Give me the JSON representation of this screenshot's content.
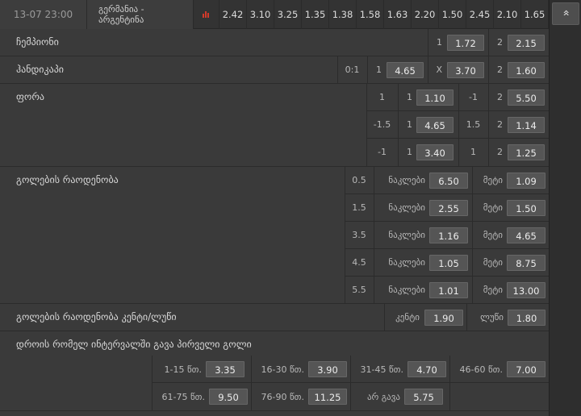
{
  "header": {
    "time": "13-07 23:00",
    "team1": "გერმანია -",
    "team2": "არგენტინა",
    "odds": [
      "2.42",
      "3.10",
      "3.25",
      "1.35",
      "1.38",
      "1.58",
      "1.63",
      "2.20",
      "1.50",
      "2.45",
      "2.10",
      "1.65"
    ]
  },
  "markets": {
    "champion": {
      "title": "ჩემპიონი",
      "l1": "1",
      "v1": "1.72",
      "l2": "2",
      "v2": "2.15"
    },
    "handicap": {
      "title": "ჰანდიკაპი",
      "hc": "0:1",
      "l1": "1",
      "v1": "4.65",
      "lx": "X",
      "vx": "3.70",
      "l2": "2",
      "v2": "1.60"
    },
    "fora": {
      "title": "ფორა",
      "rows": [
        {
          "h1": "1",
          "l1": "1",
          "v1": "1.10",
          "h2": "-1",
          "l2": "2",
          "v2": "5.50"
        },
        {
          "h1": "-1.5",
          "l1": "1",
          "v1": "4.65",
          "h2": "1.5",
          "l2": "2",
          "v2": "1.14"
        },
        {
          "h1": "-1",
          "l1": "1",
          "v1": "3.40",
          "h2": "1",
          "l2": "2",
          "v2": "1.25"
        }
      ]
    },
    "goals": {
      "title": "გოლების რაოდენობა",
      "under_label": "ნაკლები",
      "over_label": "მეტი",
      "rows": [
        {
          "total": "0.5",
          "under": "6.50",
          "over": "1.09"
        },
        {
          "total": "1.5",
          "under": "2.55",
          "over": "1.50"
        },
        {
          "total": "3.5",
          "under": "1.16",
          "over": "4.65"
        },
        {
          "total": "4.5",
          "under": "1.05",
          "over": "8.75"
        },
        {
          "total": "5.5",
          "under": "1.01",
          "over": "13.00"
        }
      ]
    },
    "odd_even": {
      "title": "გოლების რაოდენობა კენტი/ლუწი",
      "odd_label": "კენტი",
      "odd_value": "1.90",
      "even_label": "ლუწი",
      "even_value": "1.80"
    },
    "first_goal": {
      "title": "დროის რომელ ინტერვალში გავა პირველი გოლი",
      "row1": [
        {
          "label": "1-15 წთ.",
          "value": "3.35"
        },
        {
          "label": "16-30 წთ.",
          "value": "3.90"
        },
        {
          "label": "31-45 წთ.",
          "value": "4.70"
        },
        {
          "label": "46-60 წთ.",
          "value": "7.00"
        }
      ],
      "row2": [
        {
          "label": "61-75 წთ.",
          "value": "9.50"
        },
        {
          "label": "76-90 წთ.",
          "value": "11.25"
        },
        {
          "label": "არ გავა",
          "value": "5.75"
        }
      ]
    }
  },
  "scroll": {
    "up_glyph": "«"
  },
  "colors": {
    "accent_red": "#d23a2a",
    "button_bg": "#555555",
    "panel_bg": "#3a3a3a"
  }
}
